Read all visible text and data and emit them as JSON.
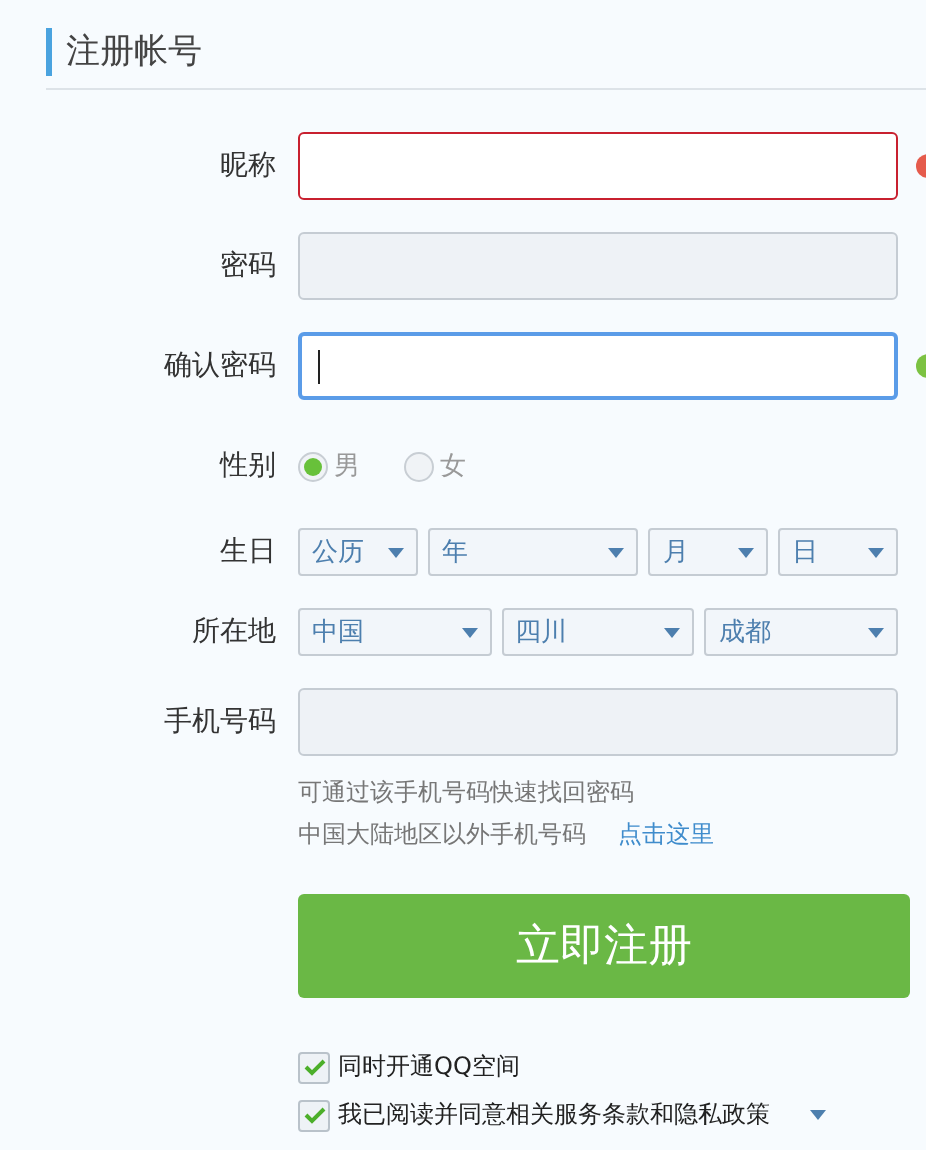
{
  "title": "注册帐号",
  "fields": [
    {
      "label": "昵称",
      "kind": "input",
      "error": true,
      "valid": false,
      "focused": false
    },
    {
      "label": "密码",
      "kind": "input",
      "error": false,
      "valid": false,
      "focused": false
    },
    {
      "label": "确认密码",
      "kind": "input",
      "error": false,
      "valid": true,
      "focused": true
    },
    {
      "label": "性别",
      "kind": "radio",
      "options": [
        {
          "label": "男",
          "selected": true
        },
        {
          "label": "女",
          "selected": false
        }
      ]
    },
    {
      "label": "生日",
      "kind": "selects",
      "selects": [
        {
          "value": "公历"
        },
        {
          "value": "年"
        },
        {
          "value": "月"
        },
        {
          "value": "日"
        }
      ]
    },
    {
      "label": "所在地",
      "kind": "selects",
      "selects": [
        {
          "value": "中国"
        },
        {
          "value": "四川"
        },
        {
          "value": "成都"
        }
      ]
    },
    {
      "label": "手机号码",
      "kind": "input",
      "error": false,
      "valid": false,
      "focused": false
    }
  ],
  "phone_hint": "可通过该手机号码快速找回密码",
  "phone_other": {
    "text": "中国大陆地区以外手机号码",
    "link": "点击这里"
  },
  "submit": "立即注册",
  "agreements": [
    {
      "label": "同时开通QQ空间",
      "checked": true,
      "dropdown": false
    },
    {
      "label": "我已阅读并同意相关服务条款和隐私政策",
      "checked": true,
      "dropdown": true
    }
  ]
}
